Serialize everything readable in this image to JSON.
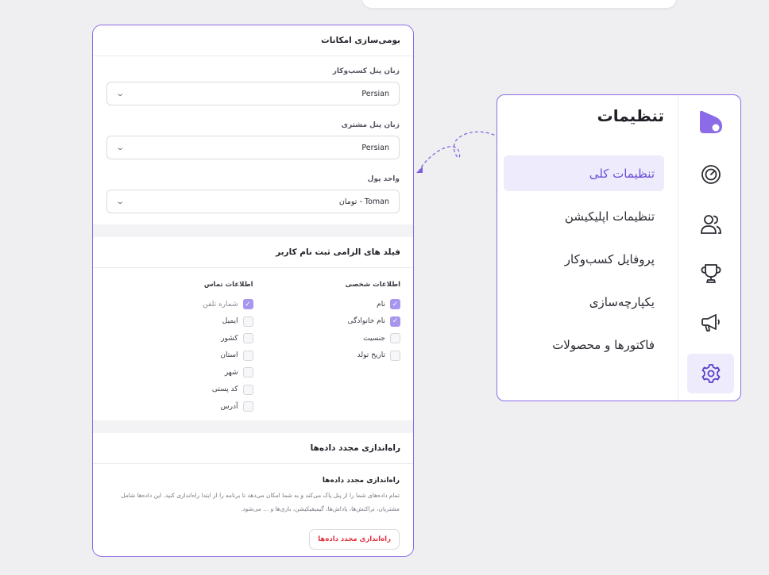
{
  "localization": {
    "title": "بومی‌سازی امکانات",
    "fields": [
      {
        "label": "زبان پنل کسب‌وکار",
        "value": "Persian"
      },
      {
        "label": "زبان پنل مشتری",
        "value": "Persian"
      },
      {
        "label": "واحد پول",
        "value": "Toman - تومان"
      }
    ]
  },
  "required_fields": {
    "title": "فیلد های الزامی ثبت نام کاربر",
    "personal": {
      "title": "اطلاعات شخصی",
      "items": [
        {
          "label": "نام",
          "checked": true
        },
        {
          "label": "نام خانوادگی",
          "checked": true
        },
        {
          "label": "جنسیت",
          "checked": false
        },
        {
          "label": "تاریخ تولد",
          "checked": false
        }
      ]
    },
    "contact": {
      "title": "اطلاعات تماس",
      "items": [
        {
          "label": "شماره تلفن",
          "checked": true
        },
        {
          "label": "ایمیل",
          "checked": false
        },
        {
          "label": "کشور",
          "checked": false
        },
        {
          "label": "استان",
          "checked": false
        },
        {
          "label": "شهر",
          "checked": false
        },
        {
          "label": "کد پستی",
          "checked": false
        },
        {
          "label": "آدرس",
          "checked": false
        }
      ]
    }
  },
  "reset": {
    "title": "راه‌اندازی مجدد داده‌ها",
    "subtitle": "راه‌اندازی مجدد داده‌ها",
    "description": "تمام داده‌های شما را از پنل پاک می‌کند و به شما امکان می‌دهد تا برنامه را از ابتدا راه‌اندازی کنید. این داده‌ها شامل مشتریان، تراکنش‌ها، پاداش‌ها، گیمیفیکیشن، بازی‌ها و ... می‌شود.",
    "button": "راه‌اندازی مجدد داده‌ها"
  },
  "menu": {
    "title": "تنظیمات",
    "items": [
      {
        "label": "تنظیمات کلی",
        "active": true
      },
      {
        "label": "تنظیمات اپلیکیشن",
        "active": false
      },
      {
        "label": "پروفایل کسب‌وکار",
        "active": false
      },
      {
        "label": "یکپارچه‌سازی",
        "active": false
      },
      {
        "label": "فاکتورها و محصولات",
        "active": false
      }
    ],
    "rail_icons": [
      "logo-icon",
      "dashboard-gauge-icon",
      "users-icon",
      "trophy-icon",
      "megaphone-icon",
      "gear-icon"
    ]
  },
  "colors": {
    "accent": "#8b6be8",
    "active_bg": "#eeebfc",
    "danger": "#e0303f"
  }
}
